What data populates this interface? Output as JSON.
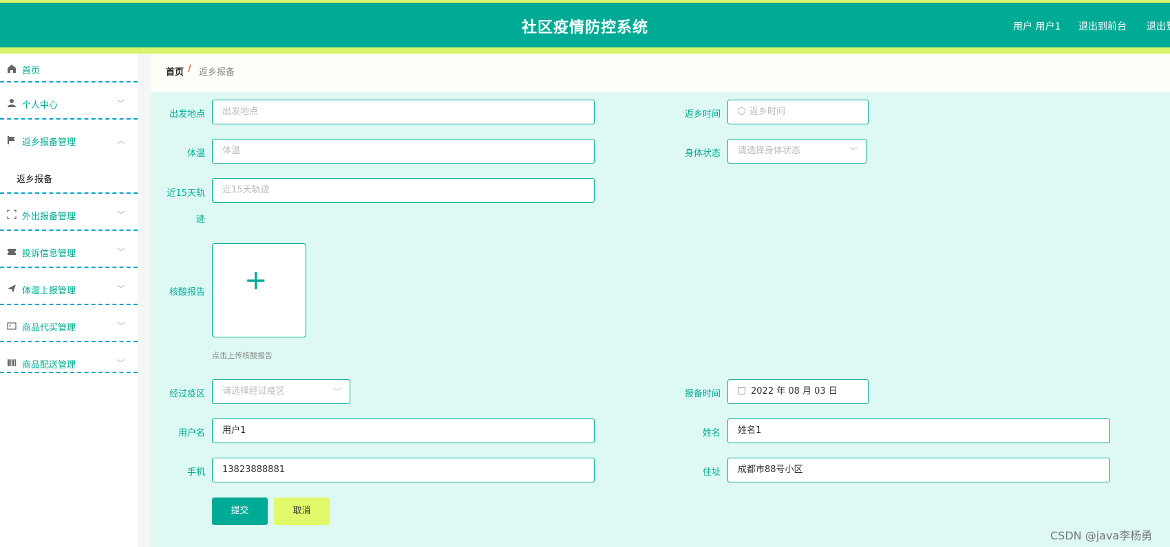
{
  "header": {
    "title": "社区疫情防控系统",
    "user_text": "用户 用户1",
    "link_frontend": "退出到前台",
    "link_logout": "退出登"
  },
  "sidebar": {
    "items": [
      {
        "label": "首页",
        "icon": "home-icon",
        "expandable": false
      },
      {
        "label": "个人中心",
        "icon": "user-icon",
        "expandable": true,
        "expanded": false
      },
      {
        "label": "返乡报备管理",
        "icon": "flag-icon",
        "expandable": true,
        "expanded": true
      },
      {
        "label": "外出报备管理",
        "icon": "scan-icon",
        "expandable": true,
        "expanded": false
      },
      {
        "label": "投诉信息管理",
        "icon": "ticket-icon",
        "expandable": true,
        "expanded": false
      },
      {
        "label": "体温上报管理",
        "icon": "send-icon",
        "expandable": true,
        "expanded": false
      },
      {
        "label": "商品代买管理",
        "icon": "card-icon",
        "expandable": true,
        "expanded": false
      },
      {
        "label": "商品配送管理",
        "icon": "barcode-icon",
        "expandable": true,
        "expanded": false
      }
    ],
    "sub_item": "返乡报备"
  },
  "breadcrumb": {
    "home": "首页",
    "separator": "/",
    "current": "返乡报备"
  },
  "form": {
    "departure": {
      "label": "出发地点",
      "placeholder": "出发地点"
    },
    "return_time": {
      "label": "返乡时间",
      "placeholder": "返乡时间"
    },
    "temperature": {
      "label": "体温",
      "placeholder": "体温"
    },
    "health_status": {
      "label": "身体状态",
      "placeholder": "请选择身体状态"
    },
    "track_label_line1": "近15天轨",
    "track_label_line2": "迹",
    "track_placeholder": "近15天轨迹",
    "nucleic": {
      "label": "核酸报告",
      "hint": "点击上传核酸报告"
    },
    "epidemic_zone": {
      "label": "经过疫区",
      "placeholder": "请选择经过疫区"
    },
    "report_time": {
      "label": "报备时间",
      "value": "2022 年 08 月 03 日"
    },
    "username": {
      "label": "用户名",
      "value": "用户1"
    },
    "name": {
      "label": "姓名",
      "value": "姓名1"
    },
    "phone": {
      "label": "手机",
      "value": "13823888881"
    },
    "address": {
      "label": "住址",
      "value": "成都市88号小区"
    }
  },
  "buttons": {
    "submit": "提交",
    "cancel": "取消"
  },
  "watermark": "CSDN @java李杨勇",
  "colors": {
    "primary": "#00ab96",
    "accent": "#d9f46a",
    "form_bg": "#def8f3",
    "separator": "#00a2c8"
  }
}
